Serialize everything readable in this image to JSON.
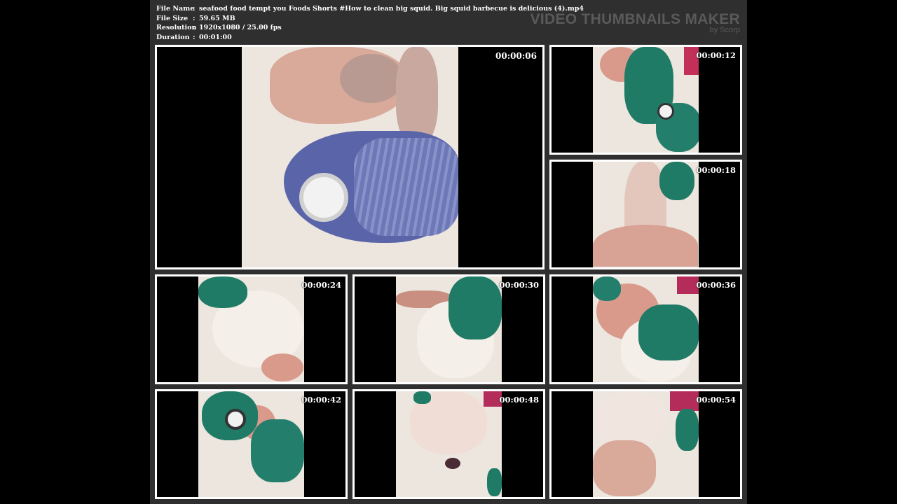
{
  "file_info": [
    {
      "label": "File Name",
      "sep": ":",
      "value": "seafood food tempt you Foods Shorts #How to clean big squid. Big squid barbecue is delicious (4).mp4"
    },
    {
      "label": "File Size",
      "sep": ":",
      "value": "59.65 MB"
    },
    {
      "label": "Resolution",
      "sep": ":",
      "value": "1920x1080 / 25.00 fps"
    },
    {
      "label": "Duration",
      "sep": ":",
      "value": "00:01:00"
    }
  ],
  "brand": {
    "title": "VIDEO THUMBNAILS MAKER",
    "subtitle": "by Scorp"
  },
  "thumbnails": [
    {
      "timestamp": "00:00:06",
      "scene": "purple glove holding tape over squid head"
    },
    {
      "timestamp": "00:00:12",
      "scene": "green gloves pulling squid beak"
    },
    {
      "timestamp": "00:00:18",
      "scene": "squid body held by green glove"
    },
    {
      "timestamp": "00:00:24",
      "scene": "green glove on squid mantle"
    },
    {
      "timestamp": "00:00:30",
      "scene": "green glove pressing squid mantle"
    },
    {
      "timestamp": "00:00:36",
      "scene": "green glove spreading squid"
    },
    {
      "timestamp": "00:00:42",
      "scene": "green gloves holding squid eye"
    },
    {
      "timestamp": "00:00:48",
      "scene": "squid mantle on board"
    },
    {
      "timestamp": "00:00:54",
      "scene": "squid tentacles and mantle"
    }
  ],
  "colors": {
    "sheet_bg": "#2f2f2f",
    "thumb_border": "#ffffff",
    "glove_green": "#1f7a66",
    "glove_purple": "#5a64a8",
    "squid_white": "#ece6df",
    "squid_pink": "#d99a8c"
  }
}
